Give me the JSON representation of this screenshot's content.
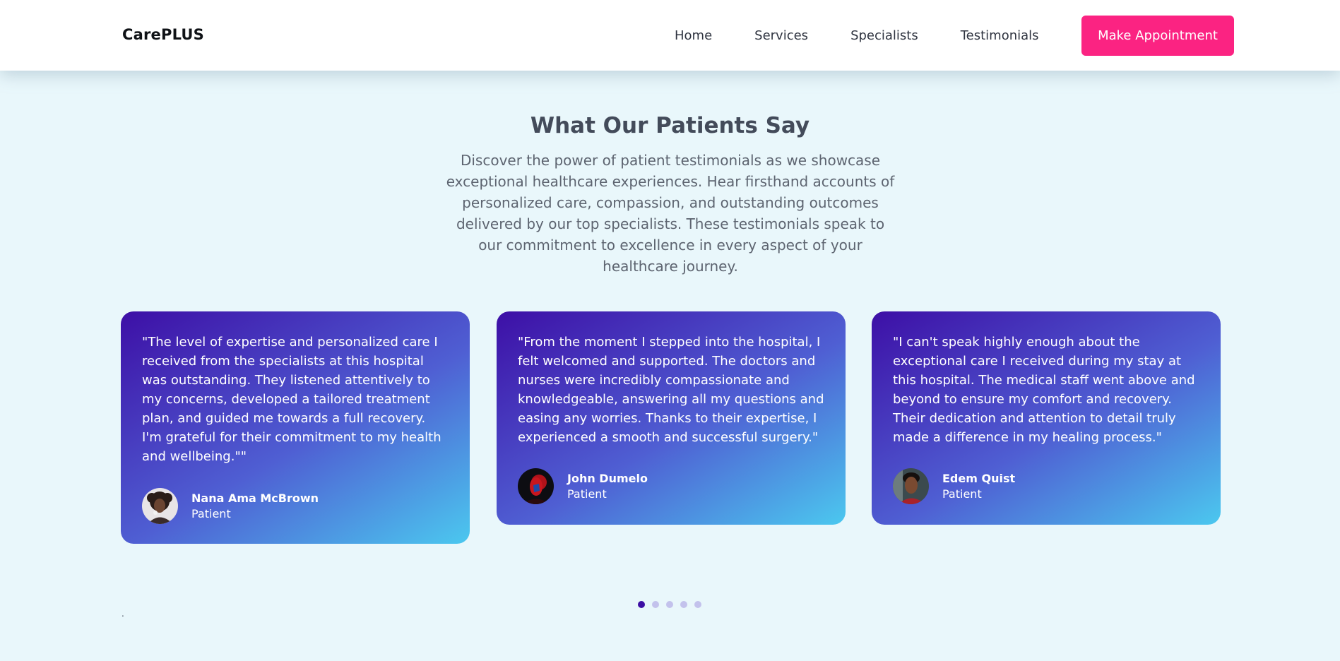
{
  "header": {
    "brand": "CarePLUS",
    "nav": [
      "Home",
      "Services",
      "Specialists",
      "Testimonials"
    ],
    "cta_label": "Make Appointment",
    "cta_color": "#fb2382"
  },
  "section": {
    "title": "What Our Patients Say",
    "description": "Discover the power of patient testimonials as we showcase exceptional healthcare experiences. Hear firsthand accounts of personalized care, compassion, and outstanding outcomes delivered by our top specialists. These testimonials speak to our commitment to excellence in every aspect of your healthcare journey."
  },
  "testimonials": [
    {
      "quote": "\"The level of expertise and personalized care I received from the specialists at this hospital was outstanding. They listened attentively to my concerns, developed a tailored treatment plan, and guided me towards a full recovery. I'm grateful for their commitment to my health and wellbeing.\"\"",
      "name": "Nana Ama McBrown",
      "role": "Patient",
      "avatar_icon": "avatar-photo-woman"
    },
    {
      "quote": "\"From the moment I stepped into the hospital, I felt welcomed and supported. The doctors and nurses were incredibly compassionate and knowledgeable, answering all my questions and easing any worries. Thanks to their expertise, I experienced a smooth and successful surgery.\"",
      "name": "John Dumelo",
      "role": "Patient",
      "avatar_icon": "avatar-photo-man-red"
    },
    {
      "quote": "\"I can't speak highly enough about the exceptional care I received during my stay at this hospital. The medical staff went above and beyond to ensure my comfort and recovery. Their dedication and attention to detail truly made a difference in my healing process.\"",
      "name": "Edem Quist",
      "role": "Patient",
      "avatar_icon": "avatar-photo-man"
    }
  ],
  "carousel": {
    "dot_count": 5,
    "active_index": 0
  },
  "footer_mark": ".",
  "colors": {
    "background": "#e9f7fb",
    "card_gradient_start": "#3d0fa6",
    "card_gradient_end": "#4bc8ef",
    "dot_active": "#3c0ea4",
    "dot_inactive": "#c3c2ec"
  }
}
